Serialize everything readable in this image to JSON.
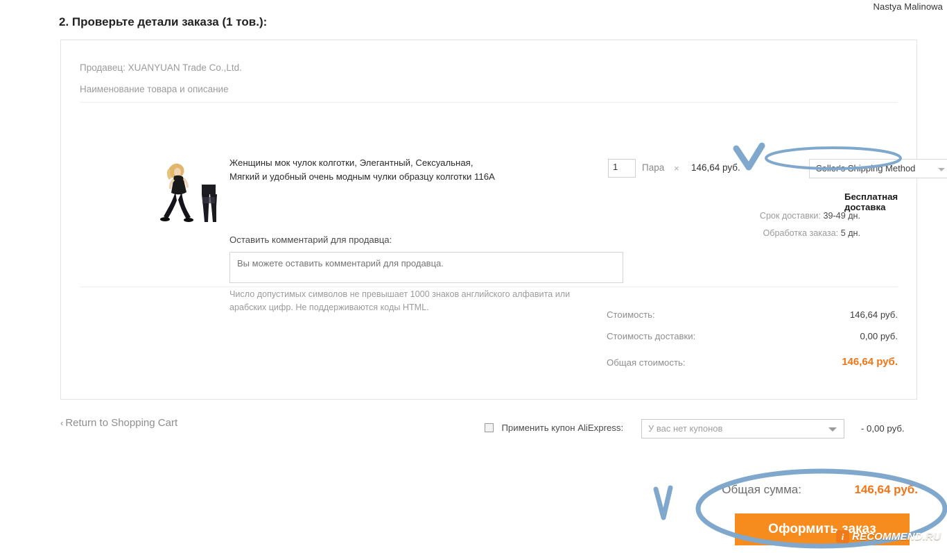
{
  "user": {
    "name": "Nastya Malinowa"
  },
  "section": {
    "title": "2. Проверьте детали заказа (1 тов.):"
  },
  "order_panel": {
    "seller": "Продавец: XUANYUAN Trade Co.,Ltd.",
    "goods_header": "Наименование товара и описание",
    "product": {
      "title": "Женщины мок чулок колготки, Элегантный, Сексуальная, Мягкий и удобный очень модным чулки образцу колготки 116A",
      "quantity": "1",
      "unit": "Пара",
      "multiply_symbol": "×",
      "unit_price": "146,64 руб."
    },
    "shipping": {
      "method": "Seller's Shipping Method",
      "free_shipping": "Бесплатная доставка",
      "delivery_time_label": "Срок доставки:",
      "delivery_time_value": "39-49 дн.",
      "processing_label": "Обработка заказа:",
      "processing_value": "5 дн."
    },
    "comment": {
      "label": "Оставить комментарий для продавца:",
      "placeholder": "Вы можете оставить комментарий для продавца.",
      "hint": "Число допустимых символов не превышает 1000 знаков английского алфавита или арабских цифр. Не поддерживаются коды HTML."
    },
    "costs": [
      {
        "label": "Стоимость:",
        "value": "146,64 руб."
      },
      {
        "label": "Стоимость доставки:",
        "value": "0,00 руб."
      },
      {
        "label": "Общая стоимость:",
        "value": "146,64 руб."
      }
    ]
  },
  "footer": {
    "return_link": "Return to Shopping Cart",
    "return_chevron": "‹",
    "coupon_label": "Применить купон AliExpress:",
    "coupon_placeholder": "У вас нет купонов",
    "coupon_discount": "- 0,00 руб.",
    "grand_total_label": "Общая сумма:",
    "grand_total_value": "146,64 руб.",
    "cta_label": "Оформить заказ"
  },
  "watermark": {
    "badge": "i",
    "name": "RECOMMEND",
    "tld": ".RU"
  },
  "colors": {
    "accent_orange": "#ef7518",
    "button_orange": "#f68b1e",
    "annotation_blue": "#7fa8cc",
    "muted_gray": "#9b9b9b"
  }
}
